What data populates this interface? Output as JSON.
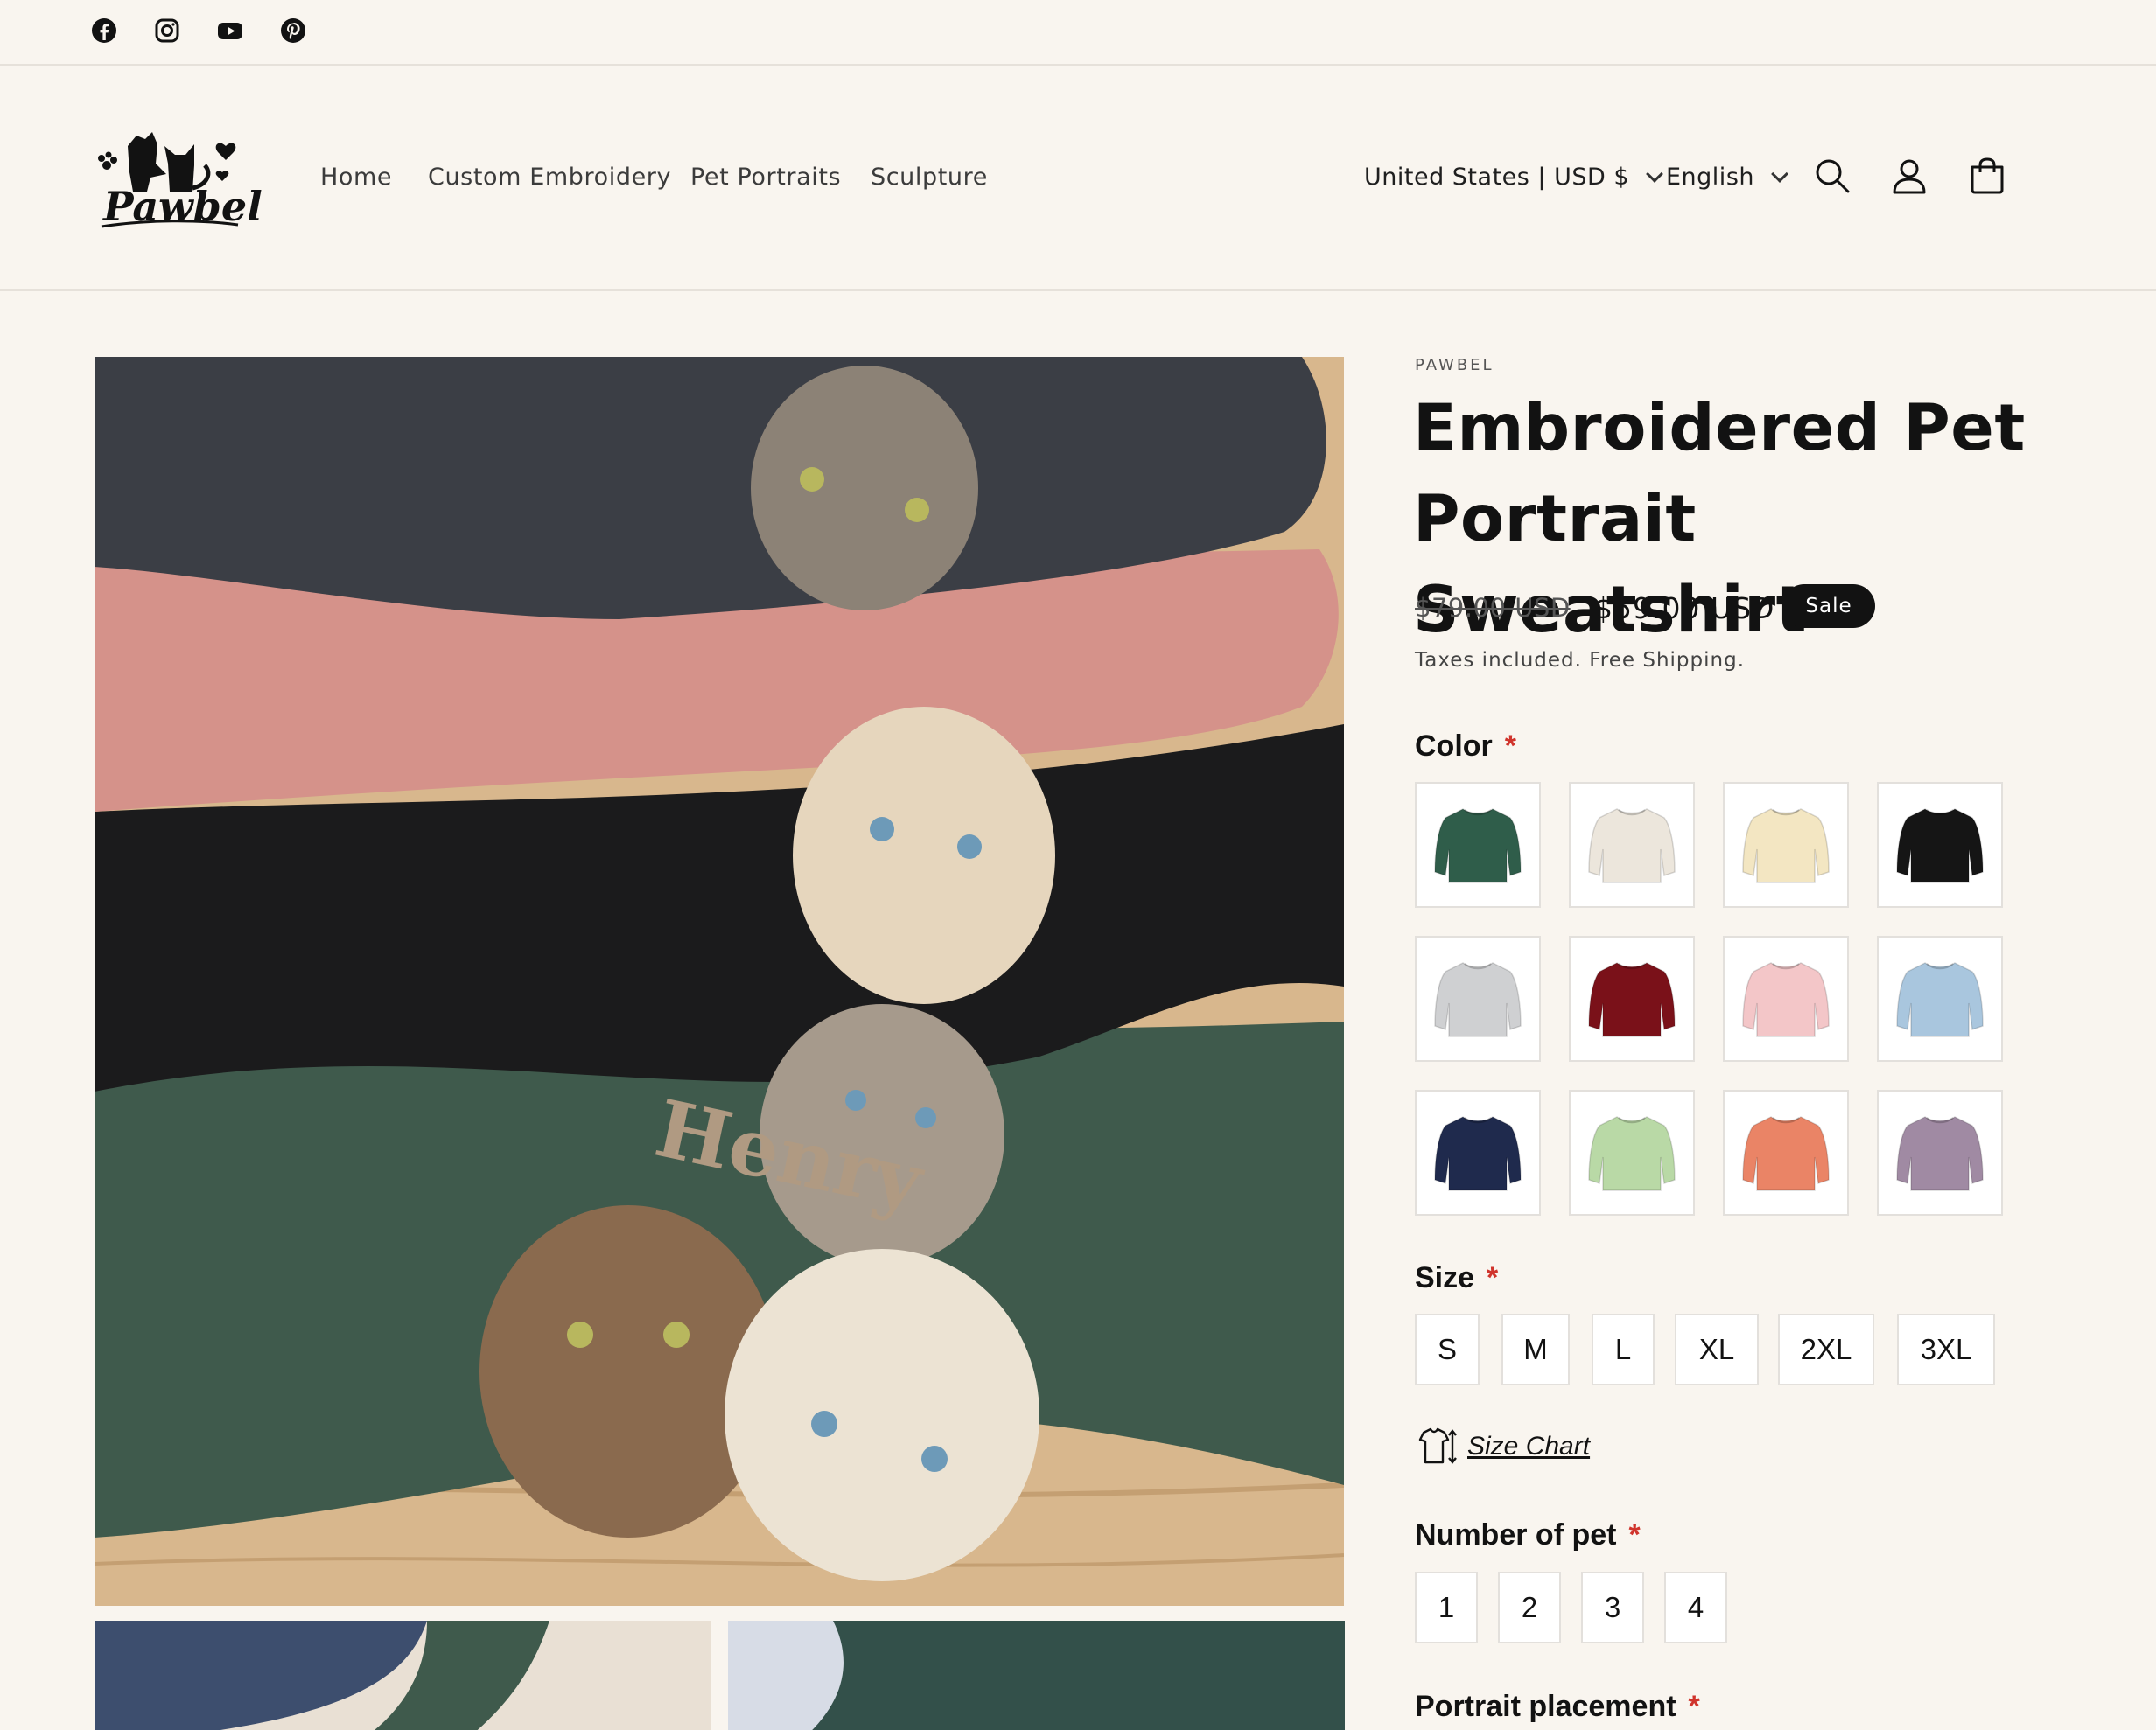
{
  "social": {
    "icons": [
      "facebook-icon",
      "instagram-icon",
      "youtube-icon",
      "pinterest-icon"
    ]
  },
  "header": {
    "logo_text": "Pawbel",
    "nav": [
      "Home",
      "Custom Embroidery",
      "Pet Portraits",
      "Sculpture"
    ],
    "country_selector": "United States | USD $",
    "language_selector": "English",
    "icons": [
      "search-icon",
      "account-icon",
      "cart-icon"
    ]
  },
  "gallery": {
    "main_image_text": "Henry"
  },
  "product": {
    "vendor": "PAWBEL",
    "title": "Embroidered Pet Portrait Sweatshirt",
    "price_original": "$79.00 USD",
    "price_sale": "$59.00 USD",
    "sale_badge": "Sale",
    "tax_note": "Taxes included. Free Shipping.",
    "color": {
      "label": "Color",
      "required_mark": "*",
      "swatches": [
        "#2f5d4a",
        "#ece6dc",
        "#f3e6c2",
        "#151515",
        "#cfd0d2",
        "#7a1119",
        "#f3c6c8",
        "#a9c6de",
        "#1f2a4d",
        "#b9d9a6",
        "#ea8466",
        "#a08aa3"
      ]
    },
    "size": {
      "label": "Size",
      "required_mark": "*",
      "options": [
        "S",
        "M",
        "L",
        "XL",
        "2XL",
        "3XL"
      ]
    },
    "size_chart_link": "Size Chart",
    "pets": {
      "label": "Number of pet",
      "required_mark": "*",
      "options": [
        "1",
        "2",
        "3",
        "4"
      ]
    },
    "placement": {
      "label": "Portrait placement",
      "required_mark": "*"
    }
  },
  "colors": {
    "sale_badge_bg": "#121212",
    "required": "#d0342c",
    "page_bg": "#f9f5ef"
  }
}
